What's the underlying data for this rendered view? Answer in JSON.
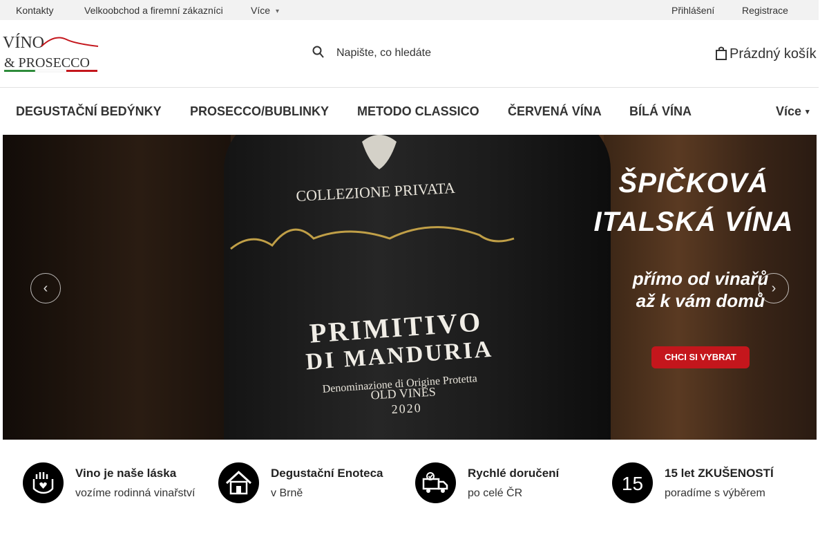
{
  "topbar": {
    "links": [
      "Kontakty",
      "Velkoobchod a firemní zákazníci",
      "Více"
    ],
    "login": "Přihlášení",
    "register": "Registrace"
  },
  "header": {
    "logo_line1": "VÍNO",
    "logo_line2": "& PROSECCO",
    "search_placeholder": "Napište, co hledáte",
    "cart_label": "Prázdný košík"
  },
  "nav": {
    "items": [
      "DEGUSTAČNÍ BEDÝNKY",
      "PROSECCO/BUBLINKY",
      "METODO CLASSICO",
      "ČERVENÁ VÍNA",
      "BÍLÁ VÍNA"
    ],
    "more": "Více"
  },
  "hero": {
    "headline_line1": "ŠPIČKOVÁ",
    "headline_line2": "ITALSKÁ VÍNA",
    "sub_line1": "přímo od vinařů",
    "sub_line2": "až k vám domů",
    "cta": "CHCI SI VYBRAT",
    "bottle_text": {
      "collection": "COLLEZIONE PRIVATA",
      "wine1": "PRIMITIVO",
      "wine2": "DI MANDURIA",
      "denomination": "Denominazione di Origine Protetta",
      "old_vines": "OLD VINES",
      "year": "2020"
    },
    "colors": {
      "cta": "#c4161c"
    }
  },
  "features": [
    {
      "title": "Vino je naše láska",
      "subtitle": "vozíme rodinná vinařství",
      "icon": "hands-heart-icon"
    },
    {
      "title": "Degustační Enoteca",
      "subtitle": "v Brně",
      "icon": "house-icon"
    },
    {
      "title": "Rychlé doručení",
      "subtitle": "po celé ČR",
      "icon": "delivery-truck-icon"
    },
    {
      "title": "15 let ZKUŠENOSTÍ",
      "subtitle": "poradíme s výběrem",
      "icon": "number-15-icon",
      "badge": "15"
    }
  ]
}
